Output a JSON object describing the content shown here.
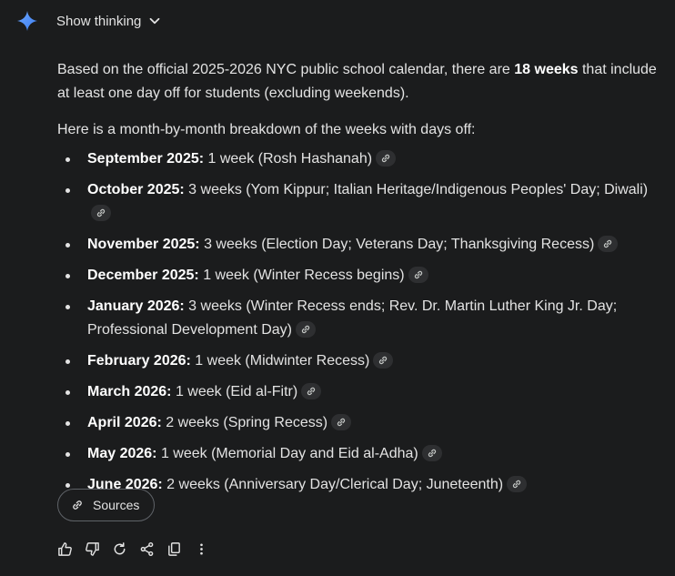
{
  "header": {
    "thinking_label": "Show thinking"
  },
  "intro": {
    "before": "Based on the official 2025-2026 NYC public school calendar, there are ",
    "bold": "18 weeks",
    "after": " that include at least one day off for students (excluding weekends)."
  },
  "breakdown_label": "Here is a month-by-month breakdown of the weeks with days off:",
  "months": [
    {
      "month": "September 2025:",
      "detail": " 1 week (Rosh Hashanah)"
    },
    {
      "month": "October 2025:",
      "detail": " 3 weeks (Yom Kippur; Italian Heritage/Indigenous Peoples' Day; Diwali)"
    },
    {
      "month": "November 2025:",
      "detail": " 3 weeks (Election Day; Veterans Day; Thanksgiving Recess)"
    },
    {
      "month": "December 2025:",
      "detail": " 1 week (Winter Recess begins)"
    },
    {
      "month": "January 2026:",
      "detail": " 3 weeks (Winter Recess ends; Rev. Dr. Martin Luther King Jr. Day; Professional Development Day)"
    },
    {
      "month": "February 2026:",
      "detail": " 1 week (Midwinter Recess)"
    },
    {
      "month": "March 2026:",
      "detail": " 1 week (Eid al-Fitr)"
    },
    {
      "month": "April 2026:",
      "detail": " 2 weeks (Spring Recess)"
    },
    {
      "month": "May 2026:",
      "detail": " 1 week (Memorial Day and Eid al-Adha)"
    },
    {
      "month": "June 2026:",
      "detail": " 2 weeks (Anniversary Day/Clerical Day; Juneteenth)"
    }
  ],
  "sources_label": "Sources",
  "colors": {
    "background": "#1b1c1d",
    "text": "#e3e3e3",
    "sparkle": "#4b8df8"
  },
  "icons": [
    "gemini-sparkle-icon",
    "chevron-down-icon",
    "link-icon",
    "thumbs-up-icon",
    "thumbs-down-icon",
    "redo-icon",
    "share-icon",
    "copy-icon",
    "more-vert-icon"
  ]
}
